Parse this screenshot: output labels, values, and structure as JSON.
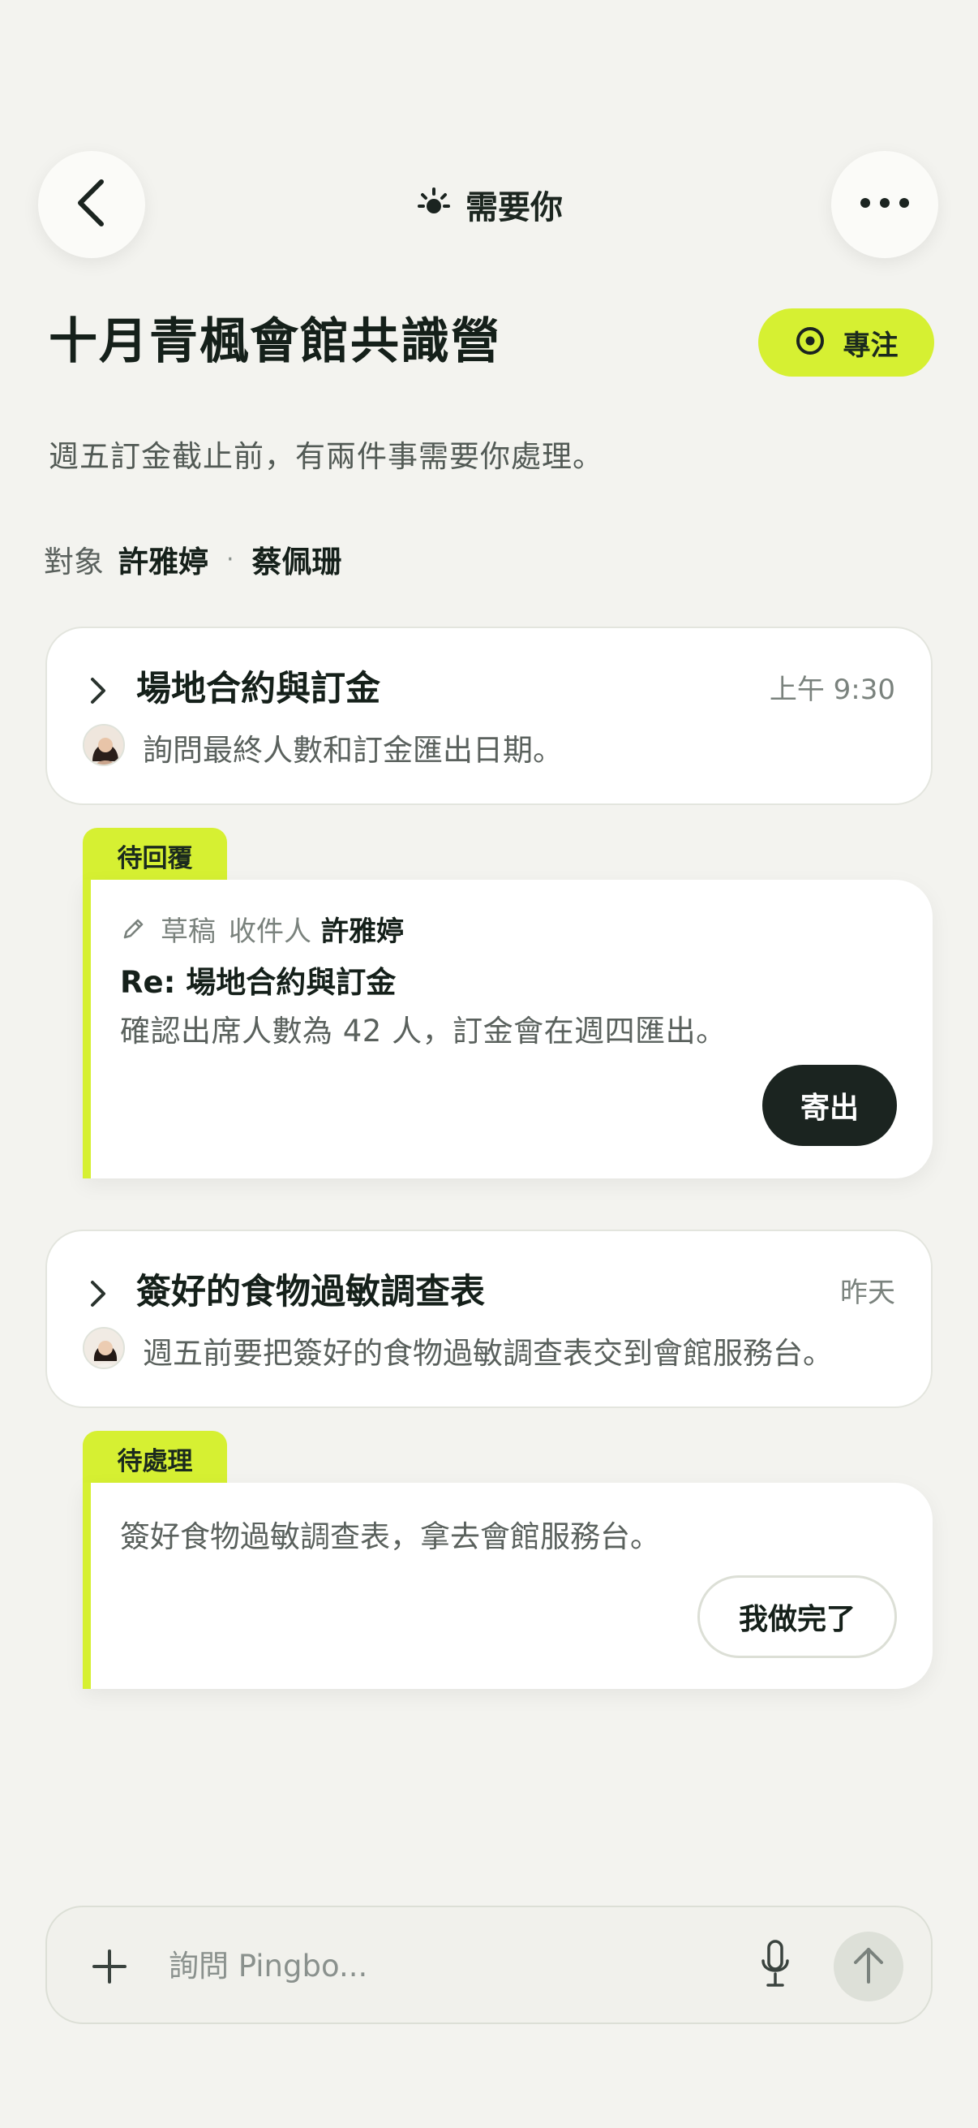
{
  "header": {
    "title": "需要你",
    "title_icon": "sun-icon",
    "back_icon": "chevron-left-icon",
    "more_icon": "more-horizontal-icon"
  },
  "page": {
    "title": "十月青楓會館共識營",
    "focus_label": "專注",
    "focus_icon": "target-icon",
    "subtitle": "週五訂金截止前，有兩件事需要你處理。",
    "recipients_label": "對象",
    "recipients": [
      "許雅婷",
      "蔡佩珊"
    ],
    "separator": "·"
  },
  "threads": [
    {
      "title": "場地合約與訂金",
      "time": "上午 9:30",
      "preview": "詢問最終人數和訂金匯出日期。",
      "status": "待回覆",
      "draft": {
        "prefix": "草稿",
        "to_label": "收件人",
        "to_name": "許雅婷",
        "subject": "Re: 場地合約與訂金",
        "body": "確認出席人數為 42 人，訂金會在週四匯出。",
        "send_label": "寄出"
      }
    },
    {
      "title": "簽好的食物過敏調查表",
      "time": "昨天",
      "preview": "週五前要把簽好的食物過敏調查表交到會館服務台。",
      "status": "待處理",
      "task": {
        "text": "簽好食物過敏調查表，拿去會館服務台。",
        "done_label": "我做完了"
      }
    }
  ],
  "composer": {
    "placeholder": "詢問 Pingbo...",
    "value": ""
  },
  "colors": {
    "accent": "#d6f032",
    "background": "#f3f3ef",
    "dark": "#1b2420"
  }
}
